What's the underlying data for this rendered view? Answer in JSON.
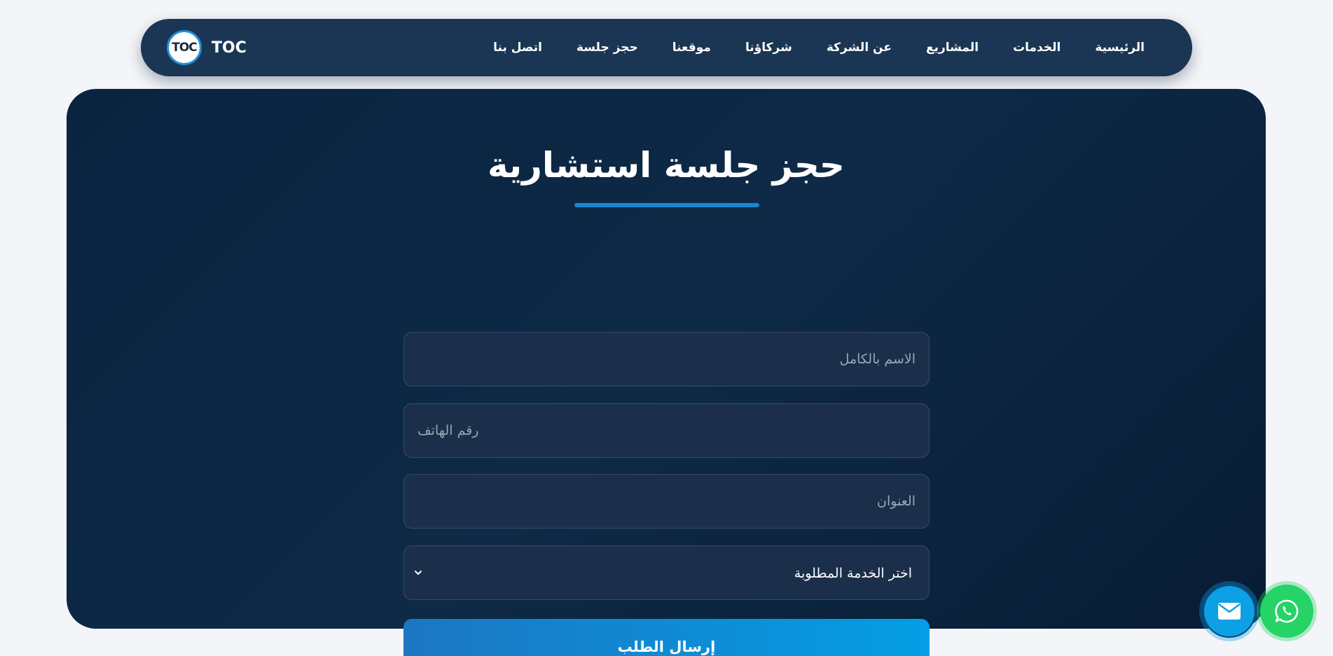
{
  "navbar": {
    "brand_logo_text": "TOC",
    "brand_name": "TOC",
    "links": [
      {
        "label": "الرئيسية"
      },
      {
        "label": "الخدمات"
      },
      {
        "label": "المشاريع"
      },
      {
        "label": "عن الشركة"
      },
      {
        "label": "شركاؤنا"
      },
      {
        "label": "موقعنا"
      },
      {
        "label": "حجز جلسة"
      },
      {
        "label": "اتصل بنا"
      }
    ]
  },
  "booking": {
    "title": "حجز جلسة استشارية",
    "name_placeholder": "الاسم بالكامل",
    "phone_placeholder": "رقم الهاتف",
    "address_placeholder": "العنوان",
    "service_select_value": "اختر الخدمة المطلوبة",
    "submit_label": "إرسال الطلب"
  },
  "floating": {
    "email_icon": "envelope-icon",
    "whatsapp_icon": "whatsapp-icon"
  },
  "colors": {
    "navbar_bg": "#1b3654",
    "card_bg": "#0a2340",
    "accent": "#1a87d2",
    "submit_start": "#1c76c2",
    "submit_end": "#039ee4",
    "whatsapp": "#25d366",
    "email": "#0ea0e4"
  }
}
